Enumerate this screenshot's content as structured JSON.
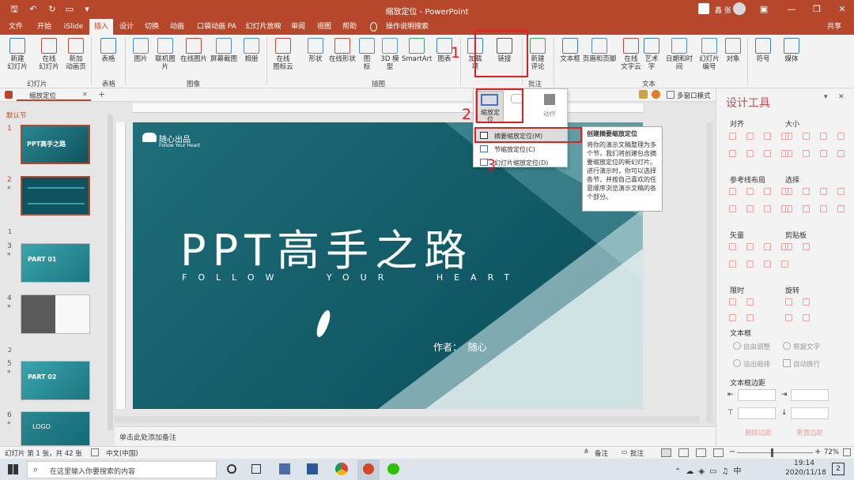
{
  "window": {
    "title": "缩放定位 - PowerPoint",
    "user": "鑫 张"
  },
  "tabs": [
    "文件",
    "开始",
    "iSlide",
    "插入",
    "设计",
    "切换",
    "动画",
    "口袋动画 PA",
    "幻灯片放映",
    "审阅",
    "视图",
    "帮助",
    "操作说明搜索",
    "共享"
  ],
  "ribbon": {
    "buttons": [
      {
        "label": "新建\n幻灯片",
        "sub": "幻灯片"
      },
      {
        "label": "在线\n幻灯片"
      },
      {
        "label": "新加\n动画页"
      },
      {
        "label": "表格"
      },
      {
        "label": "图片"
      },
      {
        "label": "联机图片"
      },
      {
        "label": "在线图片"
      },
      {
        "label": "屏幕截图"
      },
      {
        "label": "相册"
      },
      {
        "label": "在线\n图标云"
      },
      {
        "label": "形状"
      },
      {
        "label": "在线形状"
      },
      {
        "label": "图\n标"
      },
      {
        "label": "3D 模\n型"
      },
      {
        "label": "SmartArt"
      },
      {
        "label": "图表"
      },
      {
        "label": "加载\n项"
      },
      {
        "label": "链接"
      },
      {
        "label": "新建\n评论"
      },
      {
        "label": "文本框"
      },
      {
        "label": "页眉和页脚"
      },
      {
        "label": "在线\n文字云"
      },
      {
        "label": "艺术字"
      },
      {
        "label": "日期和时间"
      },
      {
        "label": "幻灯片\n编号"
      },
      {
        "label": "对象"
      },
      {
        "label": "符号"
      },
      {
        "label": "媒体"
      }
    ],
    "groups": {
      "slides": "幻灯片",
      "tables": "表格",
      "images": "图像",
      "illustrations": "插图",
      "comments": "批注",
      "text": "文本"
    }
  },
  "doc_tab": "缩放定位",
  "multiwindow": "多窗口模式",
  "section_label": "默认节",
  "thumbs": [
    {
      "num": "1",
      "text": "PPT高手之路"
    },
    {
      "num": "2",
      "text": ""
    },
    {
      "num": "3",
      "text": "PART 01"
    },
    {
      "num": "4",
      "text": ""
    },
    {
      "num": "5",
      "text": "PART 02"
    },
    {
      "num": "6",
      "text": "LOGO"
    }
  ],
  "thumb_sections": [
    "1",
    "2"
  ],
  "slide": {
    "logo": "随心出品",
    "logo_sub": "Follow Your Heart",
    "title": "PPT高手之路",
    "subtitle": "FOLLOW   YOUR   HEART",
    "author": "作者：  随心"
  },
  "dropdown": {
    "big_items": [
      "缩放定\n位",
      "动作"
    ],
    "items": [
      "摘要缩放定位(M)",
      "节缩放定位(C)",
      "幻灯片缩放定位(D)"
    ]
  },
  "tooltip": {
    "title": "创建摘要缩放定位",
    "body": "将你的演示文稿整理为多个节，我们将创建包含摘要缩放定位的新幻灯片。进行演示时，你可以选择各节，并按自己喜欢的任意顺序浏览演示文稿的各个部分。"
  },
  "annotations": [
    "1",
    "2",
    "3"
  ],
  "notes_placeholder": "单击此处添加备注",
  "design_pane": {
    "title": "设计工具",
    "sections": [
      "对齐",
      "大小",
      "参考线布局",
      "选择",
      "矢量",
      "剪贴板",
      "限时",
      "旋转",
      "文本框"
    ],
    "radios": [
      "自由调整",
      "根据文字",
      "溢出缩排",
      "自动换行"
    ],
    "margin_title": "文本框边距",
    "buttons": [
      "删除边距",
      "重置边距"
    ]
  },
  "status": {
    "slide": "幻灯片 第 1 张，共 42 张",
    "lang": "中文(中国)",
    "notes": "备注",
    "comments": "批注",
    "zoom": "72%"
  },
  "taskbar": {
    "search": "在这里输入你要搜索的内容",
    "time": "19:14",
    "date": "2020/11/18",
    "notif": "2"
  },
  "colors": {
    "accent": "#b7472a",
    "annotation": "#e02020",
    "slide": "#15606c"
  }
}
